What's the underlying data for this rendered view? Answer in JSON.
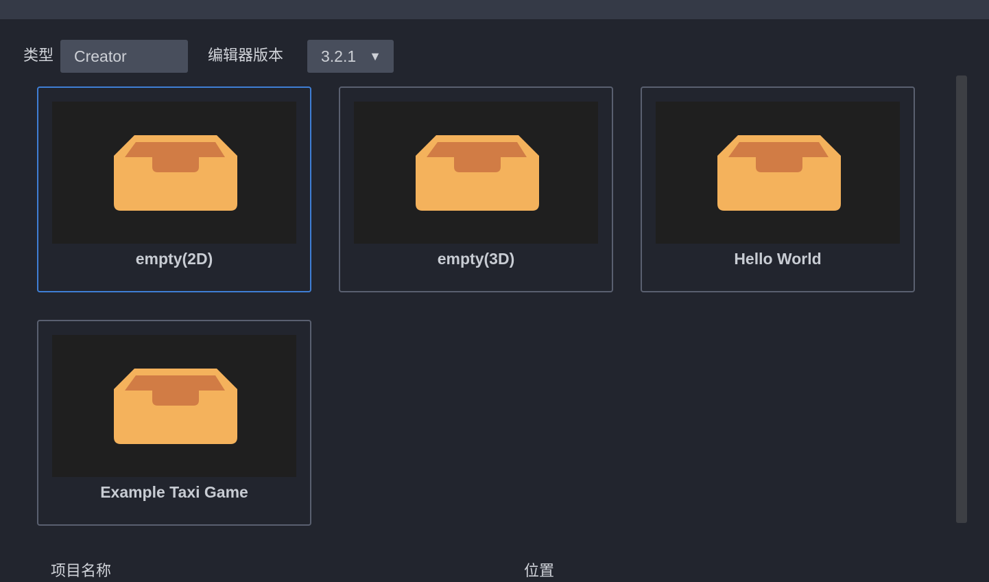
{
  "filters": {
    "type_label": "类型",
    "type_value": "Creator",
    "version_label": "编辑器版本",
    "version_value": "3.2.1",
    "dropdown_arrow": "▼"
  },
  "templates": [
    {
      "title": "empty(2D)",
      "icon": "box-icon",
      "selected": true
    },
    {
      "title": "empty(3D)",
      "icon": "box-icon",
      "selected": false
    },
    {
      "title": "Hello World",
      "icon": "box-icon",
      "selected": false
    },
    {
      "title": "Example Taxi Game",
      "icon": "box-icon",
      "selected": false
    }
  ],
  "footer": {
    "project_name_label": "项目名称",
    "location_label": "位置"
  },
  "colors": {
    "background": "#22252e",
    "selected_border": "#3f7fd6",
    "card_border": "#5a6070",
    "box_body": "#f4b25c",
    "box_inner": "#d17c45"
  }
}
